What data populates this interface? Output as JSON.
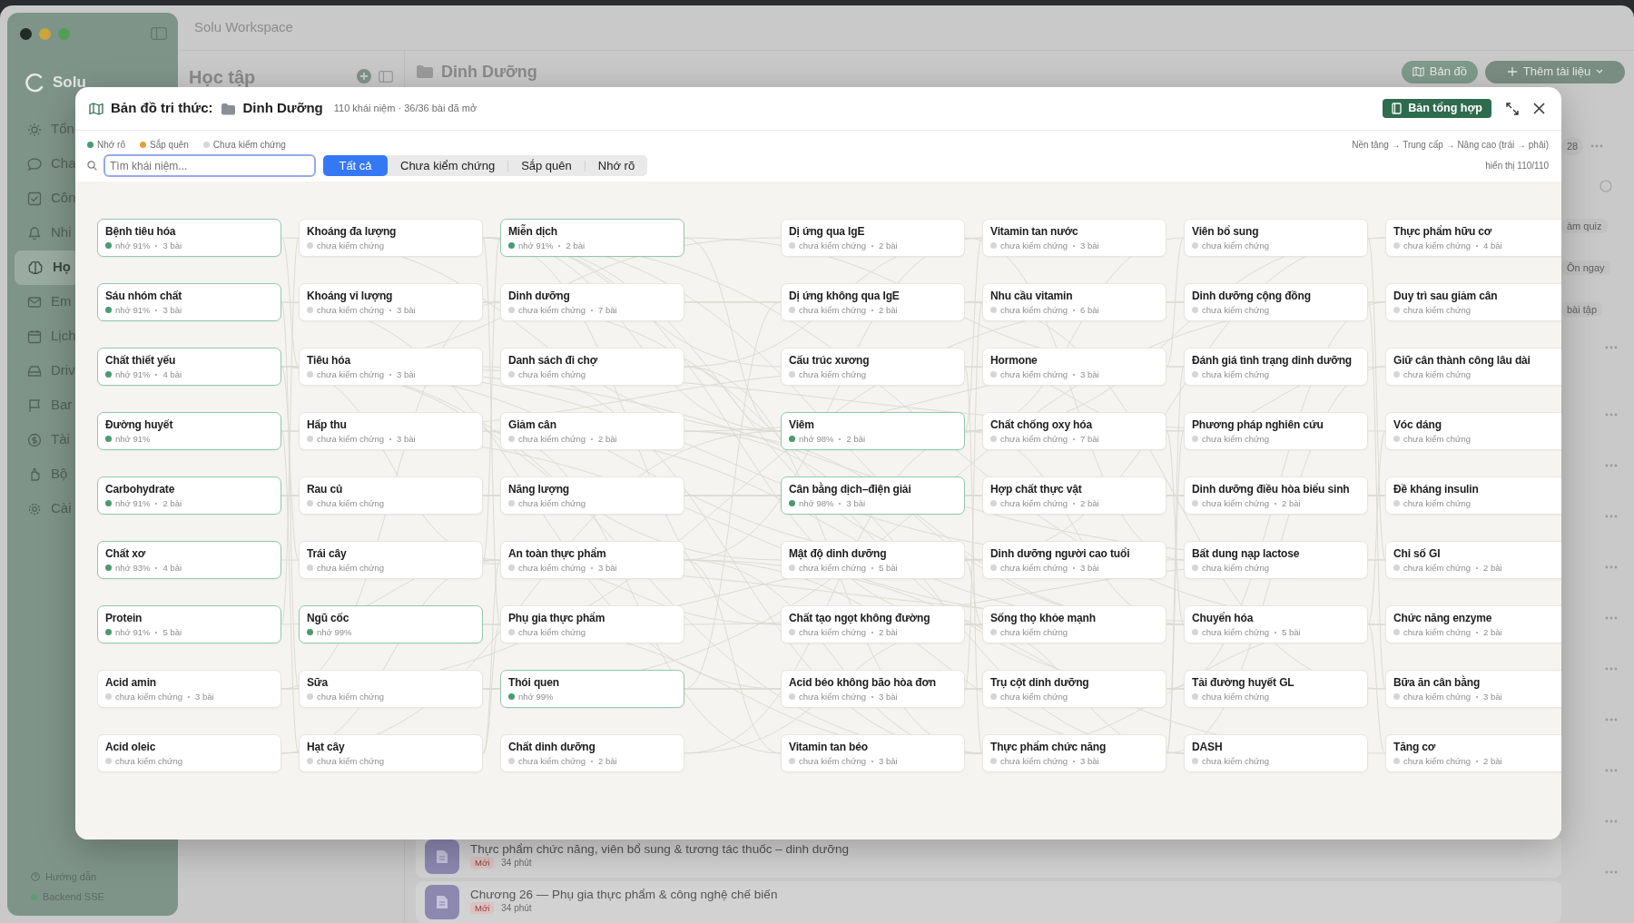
{
  "window": {
    "title": "Solu Workspace"
  },
  "sidebar": {
    "brand": "Solu",
    "items": [
      {
        "label": "Tổn",
        "selected": false
      },
      {
        "label": "Cha",
        "selected": false
      },
      {
        "label": "Côn",
        "selected": false
      },
      {
        "label": "Nhi",
        "selected": false
      },
      {
        "label": "Họ",
        "selected": true
      },
      {
        "label": "Em",
        "selected": false
      },
      {
        "label": "Lịch",
        "selected": false
      },
      {
        "label": "Driv",
        "selected": false
      },
      {
        "label": "Bar",
        "selected": false
      },
      {
        "label": "Tài",
        "selected": false
      },
      {
        "label": "Bộ",
        "selected": false
      },
      {
        "label": "Cài",
        "selected": false
      }
    ],
    "footer": [
      {
        "label": "Hướng dẫn",
        "kind": "help"
      },
      {
        "label": "Backend SSE",
        "kind": "status"
      }
    ]
  },
  "panel": {
    "title": "Học tập"
  },
  "main": {
    "folder": "Dinh Dưỡng",
    "buttons": [
      {
        "label": "Bản đồ",
        "kind": "map"
      },
      {
        "label": "Thêm tài liệu",
        "kind": "add"
      }
    ],
    "side": [
      {
        "label": "28",
        "kind": "count"
      },
      {
        "label": "àm quiz",
        "kind": "pill"
      },
      {
        "label": "Ôn ngay",
        "kind": "pill"
      },
      {
        "label": "bài tập",
        "kind": "pill"
      }
    ],
    "lessons": [
      {
        "title": "Thực phẩm chức năng, viên bổ sung & tương tác thuốc – dinh dưỡng",
        "badge": "Mới",
        "time": "34 phút"
      },
      {
        "title": "Chương 26 — Phụ gia thực phẩm & công nghệ chế biến",
        "badge": "Mới",
        "time": "34 phút"
      }
    ]
  },
  "modal": {
    "title": "Bản đồ tri thức:",
    "folder": "Dinh Dưỡng",
    "subtitle": "110 khái niệm · 36/36 bài đã mở",
    "summary_button": "Bản tổng hợp",
    "legend": [
      {
        "label": "Nhớ rõ",
        "color": "#4a9a72"
      },
      {
        "label": "Sắp quên",
        "color": "#e3a03a"
      },
      {
        "label": "Chưa kiểm chứng",
        "color": "#d6d6d6"
      }
    ],
    "direction_note": "Nền tảng → Trung cấp → Nâng cao (trái → phải)",
    "search": {
      "placeholder": "Tìm khái niệm..."
    },
    "filters": [
      {
        "label": "Tất cả",
        "selected": true
      },
      {
        "label": "Chưa kiểm chứng",
        "selected": false
      },
      {
        "label": "Sắp quên",
        "selected": false
      },
      {
        "label": "Nhớ rõ",
        "selected": false
      }
    ],
    "shown": "hiển thị 110/110",
    "columns": [
      {
        "concepts": [
          {
            "title": "Bệnh tiêu hóa",
            "remembered": true,
            "status_label": "nhớ 91%",
            "lessons": "3 bài"
          },
          {
            "title": "Sáu nhóm chất",
            "remembered": true,
            "status_label": "nhớ 91%",
            "lessons": "3 bài"
          },
          {
            "title": "Chất thiết yếu",
            "remembered": true,
            "status_label": "nhớ 91%",
            "lessons": "4 bài"
          },
          {
            "title": "Đường huyết",
            "remembered": true,
            "status_label": "nhớ 91%"
          },
          {
            "title": "Carbohydrate",
            "remembered": true,
            "status_label": "nhớ 91%",
            "lessons": "2 bài"
          },
          {
            "title": "Chất xơ",
            "remembered": true,
            "status_label": "nhớ 93%",
            "lessons": "4 bài"
          },
          {
            "title": "Protein",
            "remembered": true,
            "status_label": "nhớ 91%",
            "lessons": "5 bài"
          },
          {
            "title": "Acid amin",
            "remembered": false,
            "status_label": "chưa kiểm chứng",
            "lessons": "3 bài"
          },
          {
            "title": "Acid oleic",
            "remembered": false,
            "status_label": "chưa kiểm chứng"
          }
        ]
      },
      {
        "concepts": [
          {
            "title": "Khoáng đa lượng",
            "remembered": false,
            "status_label": "chưa kiểm chứng"
          },
          {
            "title": "Khoáng vi lượng",
            "remembered": false,
            "status_label": "chưa kiểm chứng",
            "lessons": "3 bài"
          },
          {
            "title": "Tiêu hóa",
            "remembered": false,
            "status_label": "chưa kiểm chứng",
            "lessons": "3 bài"
          },
          {
            "title": "Hấp thu",
            "remembered": false,
            "status_label": "chưa kiểm chứng",
            "lessons": "3 bài"
          },
          {
            "title": "Rau củ",
            "remembered": false,
            "status_label": "chưa kiểm chứng"
          },
          {
            "title": "Trái cây",
            "remembered": false,
            "status_label": "chưa kiểm chứng"
          },
          {
            "title": "Ngũ cốc",
            "remembered": true,
            "status_label": "nhớ 99%"
          },
          {
            "title": "Sữa",
            "remembered": false,
            "status_label": "chưa kiểm chứng"
          },
          {
            "title": "Hạt cây",
            "remembered": false,
            "status_label": "chưa kiểm chứng"
          }
        ]
      },
      {
        "concepts": [
          {
            "title": "Miễn dịch",
            "remembered": true,
            "status_label": "nhớ 91%",
            "lessons": "2 bài"
          },
          {
            "title": "Dinh dưỡng",
            "remembered": false,
            "status_label": "chưa kiểm chứng",
            "lessons": "7 bài"
          },
          {
            "title": "Danh sách đi chợ",
            "remembered": false,
            "status_label": "chưa kiểm chứng"
          },
          {
            "title": "Giảm cân",
            "remembered": false,
            "status_label": "chưa kiểm chứng",
            "lessons": "2 bài"
          },
          {
            "title": "Năng lượng",
            "remembered": false,
            "status_label": "chưa kiểm chứng"
          },
          {
            "title": "An toàn thực phẩm",
            "remembered": false,
            "status_label": "chưa kiểm chứng",
            "lessons": "3 bài"
          },
          {
            "title": "Phụ gia thực phẩm",
            "remembered": false,
            "status_label": "chưa kiểm chứng"
          },
          {
            "title": "Thói quen",
            "remembered": true,
            "status_label": "nhớ 99%"
          },
          {
            "title": "Chất dinh dưỡng",
            "remembered": false,
            "status_label": "chưa kiểm chứng",
            "lessons": "2 bài"
          }
        ]
      },
      {
        "concepts": [
          {
            "title": "Dị ứng qua IgE",
            "remembered": false,
            "status_label": "chưa kiểm chứng",
            "lessons": "2 bài"
          },
          {
            "title": "Dị ứng không qua IgE",
            "remembered": false,
            "status_label": "chưa kiểm chứng",
            "lessons": "2 bài"
          },
          {
            "title": "Cấu trúc xương",
            "remembered": false,
            "status_label": "chưa kiểm chứng"
          },
          {
            "title": "Viêm",
            "remembered": true,
            "status_label": "nhớ 98%",
            "lessons": "2 bài"
          },
          {
            "title": "Cân bằng dịch–điện giải",
            "remembered": true,
            "status_label": "nhớ 98%",
            "lessons": "3 bài"
          },
          {
            "title": "Mật độ dinh dưỡng",
            "remembered": false,
            "status_label": "chưa kiểm chứng",
            "lessons": "5 bài"
          },
          {
            "title": "Chất tạo ngọt không đường",
            "remembered": false,
            "status_label": "chưa kiểm chứng",
            "lessons": "2 bài"
          },
          {
            "title": "Acid béo không bão hòa đơn",
            "remembered": false,
            "status_label": "chưa kiểm chứng",
            "lessons": "3 bài"
          },
          {
            "title": "Vitamin tan béo",
            "remembered": false,
            "status_label": "chưa kiểm chứng",
            "lessons": "3 bài"
          }
        ]
      },
      {
        "concepts": [
          {
            "title": "Vitamin tan nước",
            "remembered": false,
            "status_label": "chưa kiểm chứng",
            "lessons": "3 bài"
          },
          {
            "title": "Nhu cầu vitamin",
            "remembered": false,
            "status_label": "chưa kiểm chứng",
            "lessons": "6 bài"
          },
          {
            "title": "Hormone",
            "remembered": false,
            "status_label": "chưa kiểm chứng",
            "lessons": "3 bài"
          },
          {
            "title": "Chất chống oxy hóa",
            "remembered": false,
            "status_label": "chưa kiểm chứng",
            "lessons": "7 bài"
          },
          {
            "title": "Hợp chất thực vật",
            "remembered": false,
            "status_label": "chưa kiểm chứng",
            "lessons": "2 bài"
          },
          {
            "title": "Dinh dưỡng người cao tuổi",
            "remembered": false,
            "status_label": "chưa kiểm chứng",
            "lessons": "3 bài"
          },
          {
            "title": "Sống thọ khỏe mạnh",
            "remembered": false,
            "status_label": "chưa kiểm chứng"
          },
          {
            "title": "Trụ cột dinh dưỡng",
            "remembered": false,
            "status_label": "chưa kiểm chứng"
          },
          {
            "title": "Thực phẩm chức năng",
            "remembered": false,
            "status_label": "chưa kiểm chứng",
            "lessons": "3 bài"
          }
        ]
      },
      {
        "concepts": [
          {
            "title": "Viên bổ sung",
            "remembered": false,
            "status_label": "chưa kiểm chứng"
          },
          {
            "title": "Dinh dưỡng cộng đồng",
            "remembered": false,
            "status_label": "chưa kiểm chứng"
          },
          {
            "title": "Đánh giá tình trạng dinh dưỡng",
            "remembered": false,
            "status_label": "chưa kiểm chứng"
          },
          {
            "title": "Phương pháp nghiên cứu",
            "remembered": false,
            "status_label": "chưa kiểm chứng"
          },
          {
            "title": "Dinh dưỡng điều hòa biểu sinh",
            "remembered": false,
            "status_label": "chưa kiểm chứng",
            "lessons": "2 bài"
          },
          {
            "title": "Bất dung nạp lactose",
            "remembered": false,
            "status_label": "chưa kiểm chứng"
          },
          {
            "title": "Chuyển hóa",
            "remembered": false,
            "status_label": "chưa kiểm chứng",
            "lessons": "5 bài"
          },
          {
            "title": "Tải đường huyết GL",
            "remembered": false,
            "status_label": "chưa kiểm chứng"
          },
          {
            "title": "DASH",
            "remembered": false,
            "status_label": "chưa kiểm chứng"
          }
        ]
      },
      {
        "concepts": [
          {
            "title": "Thực phẩm hữu cơ",
            "remembered": false,
            "status_label": "chưa kiểm chứng",
            "lessons": "4 bài"
          },
          {
            "title": "Duy trì sau giảm cân",
            "remembered": false,
            "status_label": "chưa kiểm chứng"
          },
          {
            "title": "Giữ cân thành công lâu dài",
            "remembered": false,
            "status_label": "chưa kiểm chứng"
          },
          {
            "title": "Vóc dáng",
            "remembered": false,
            "status_label": "chưa kiểm chứng"
          },
          {
            "title": "Đề kháng insulin",
            "remembered": false,
            "status_label": "chưa kiểm chứng"
          },
          {
            "title": "Chỉ số GI",
            "remembered": false,
            "status_label": "chưa kiểm chứng",
            "lessons": "2 bài"
          },
          {
            "title": "Chức năng enzyme",
            "remembered": false,
            "status_label": "chưa kiểm chứng",
            "lessons": "2 bài"
          },
          {
            "title": "Bữa ăn cân bằng",
            "remembered": false,
            "status_label": "chưa kiểm chứng",
            "lessons": "3 bài"
          },
          {
            "title": "Tăng cơ",
            "remembered": false,
            "status_label": "chưa kiểm chứng",
            "lessons": "2 bài"
          }
        ]
      }
    ]
  }
}
